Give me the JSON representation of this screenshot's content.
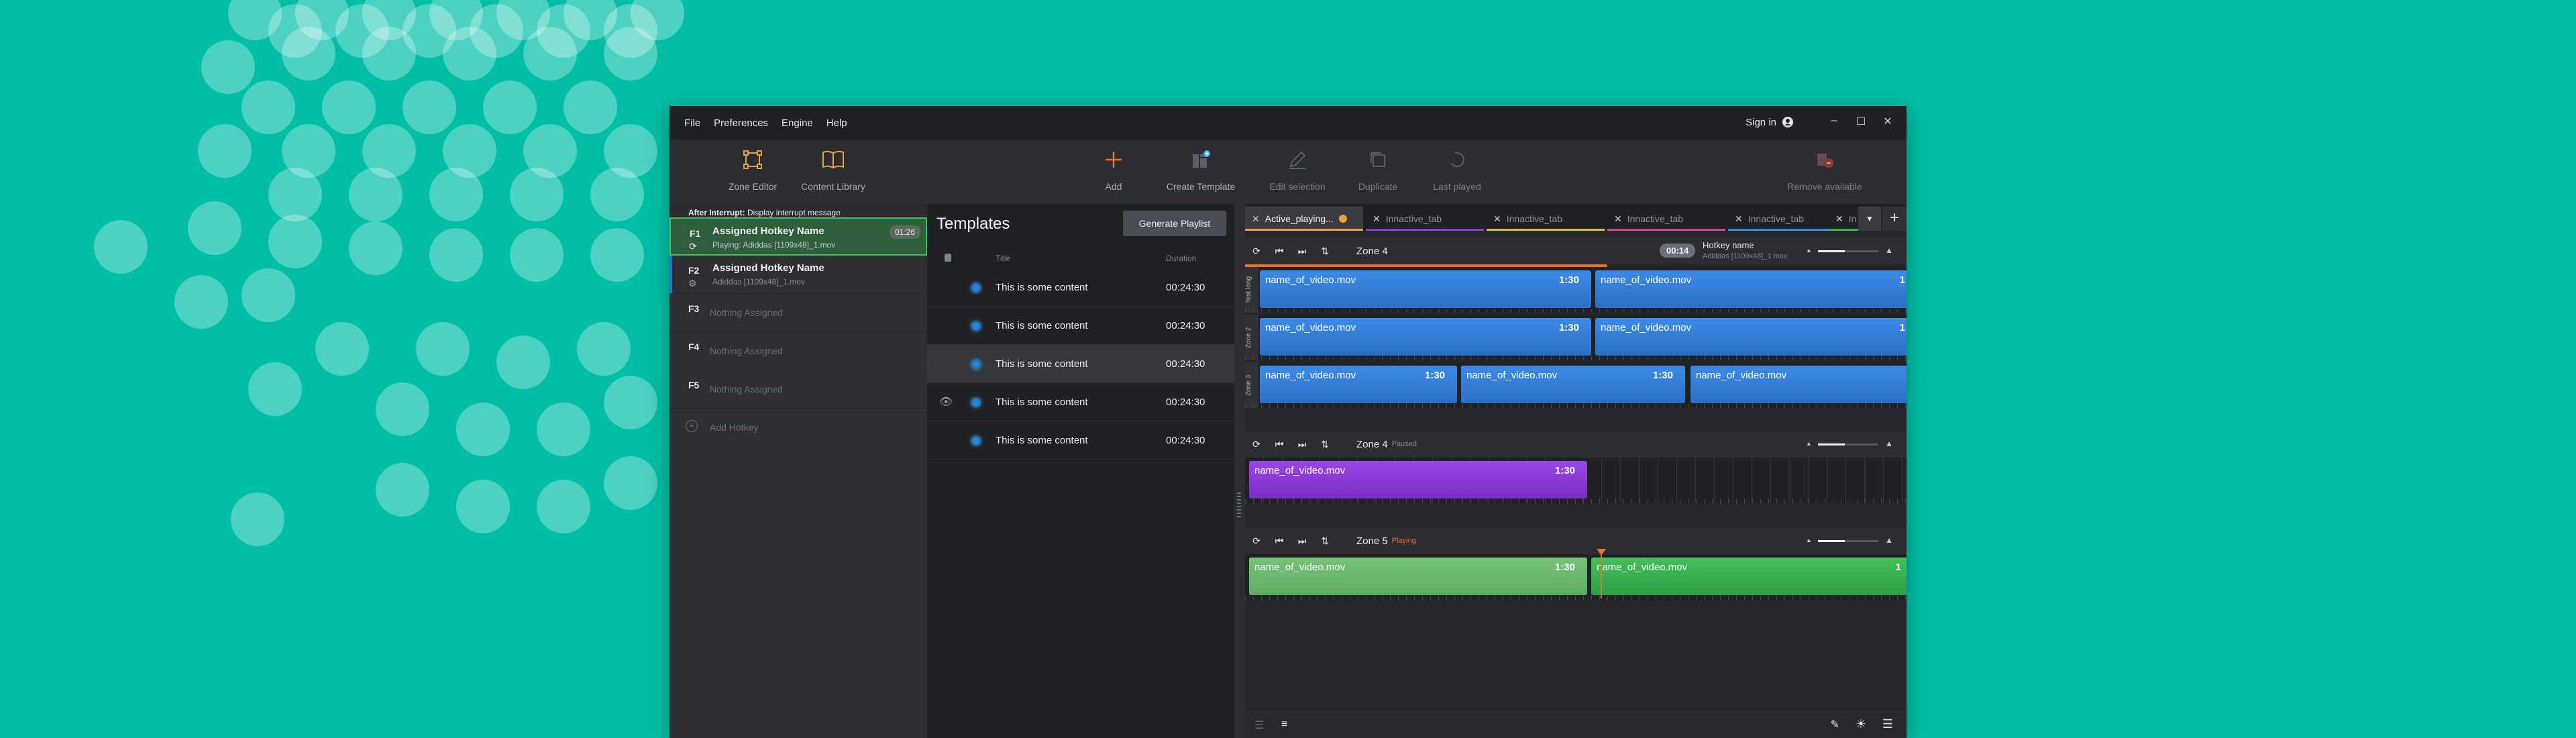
{
  "menu": {
    "items": [
      "File",
      "Preferences",
      "Engine",
      "Help"
    ],
    "sign_in": "Sign in"
  },
  "toolbar": {
    "zone_editor": "Zone Editor",
    "content_library": "Content Library",
    "add": "Add",
    "create_template": "Create Template",
    "edit_selection": "Edit selection",
    "duplicate": "Duplicate",
    "last_played": "Last played",
    "remove_available": "Remove available"
  },
  "hotkeys": {
    "interrupt_label": "After Interrupt:",
    "interrupt_value": "Display interrupt message",
    "items": [
      {
        "key": "F1",
        "name": "Assigned Hotkey Name",
        "sub": "Playing: Adiddas [1109x48]_1.mov",
        "time": "01:26"
      },
      {
        "key": "F2",
        "name": "Assigned Hotkey Name",
        "sub": "Adiddas [1109x48]_1.mov"
      },
      {
        "key": "F3",
        "empty": "Nothing Assigned"
      },
      {
        "key": "F4",
        "empty": "Nothing Assigned"
      },
      {
        "key": "F5",
        "empty": "Nothing Assigned"
      }
    ],
    "add_label": "Add Hotkey"
  },
  "templates": {
    "title": "Templates",
    "generate_button": "Generate Playlist",
    "col_title": "Title",
    "col_duration": "Duration",
    "rows": [
      {
        "title": "This is some content",
        "duration": "00:24:30"
      },
      {
        "title": "This is some content",
        "duration": "00:24:30"
      },
      {
        "title": "This is some content",
        "duration": "00:24:30"
      },
      {
        "title": "This is some content",
        "duration": "00:24:30"
      },
      {
        "title": "This is some content",
        "duration": "00:24:30"
      }
    ]
  },
  "tabs": [
    {
      "label": "Active_playing...",
      "active": true,
      "color": "#e8a23c"
    },
    {
      "label": "Innactive_tab",
      "color": "#8b3fd6"
    },
    {
      "label": "Innactive_tab",
      "color": "#d9c23a"
    },
    {
      "label": "Innactive_tab",
      "color": "#d84a8c"
    },
    {
      "label": "Innactive_tab",
      "color": "#3f8fd8"
    },
    {
      "label": "In",
      "color": "#3ab54a"
    }
  ],
  "zone_group": {
    "zone": "Zone 4",
    "time": "00:14",
    "hotkey_name": "Hotkey name",
    "hotkey_file": "Adiddas [1109x48]_1.mov",
    "tracks": [
      {
        "label": "Test long",
        "clips": [
          {
            "name": "name_of_video.mov",
            "dur": "1:30"
          },
          {
            "name": "name_of_video.mov",
            "dur": "1"
          }
        ]
      },
      {
        "label": "Zone 2",
        "clips": [
          {
            "name": "name_of_video.mov",
            "dur": "1:30"
          },
          {
            "name": "name_of_video.mov",
            "dur": "1"
          }
        ]
      },
      {
        "label": "Zone 3",
        "clips": [
          {
            "name": "name_of_video.mov",
            "dur": "1:30"
          },
          {
            "name": "name_of_video.mov",
            "dur": "1:30"
          },
          {
            "name": "name_of_video.mov",
            "dur": ""
          }
        ]
      }
    ]
  },
  "zone4": {
    "zone": "Zone 4",
    "status": "Paused",
    "clip": {
      "name": "name_of_video.mov",
      "dur": "1:30"
    }
  },
  "zone5": {
    "zone": "Zone 5",
    "status": "Playing",
    "clips": [
      {
        "name": "name_of_video.mov",
        "dur": "1:30"
      },
      {
        "name": "name_of_video.mov",
        "dur": "1"
      }
    ]
  },
  "colors": {
    "background": "#00bfa6",
    "accent_orange": "#e8742c",
    "status_paused": "#8a8e94",
    "status_playing": "#e8742c"
  }
}
